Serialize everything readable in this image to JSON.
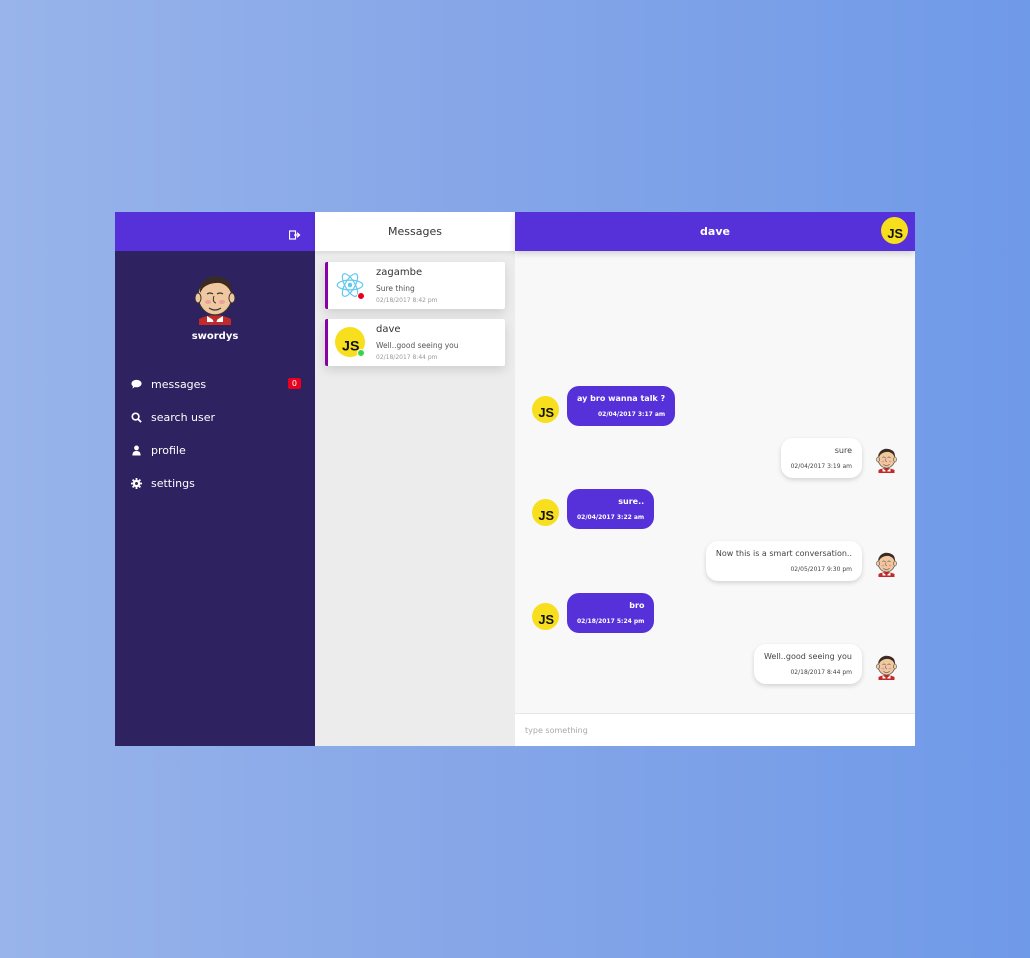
{
  "sidebar": {
    "logout_icon": "logout-icon",
    "username": "swordys",
    "nav": [
      {
        "label": "messages",
        "icon": "chat-bubble-icon",
        "badge": "0"
      },
      {
        "label": "search user",
        "icon": "search-icon"
      },
      {
        "label": "profile",
        "icon": "user-icon"
      },
      {
        "label": "settings",
        "icon": "gear-icon"
      }
    ]
  },
  "messages_list": {
    "title": "Messages",
    "conversations": [
      {
        "name": "zagambe",
        "preview": "Sure thing",
        "time": "02/18/2017 8:42 pm",
        "avatar": "react-logo-icon",
        "status_color": "#e8001e"
      },
      {
        "name": "dave",
        "preview": "Well..good seeing you",
        "time": "02/18/2017 8:44 pm",
        "avatar": "js-logo-icon",
        "status_color": "#39d24a"
      }
    ]
  },
  "chat": {
    "title": "dave",
    "messages": [
      {
        "direction": "in",
        "text": "ay bro wanna talk ?",
        "time": "02/04/2017 3:17 am"
      },
      {
        "direction": "out",
        "text": "sure",
        "time": "02/04/2017 3:19 am"
      },
      {
        "direction": "in",
        "text": "sure..",
        "time": "02/04/2017 3:22 am"
      },
      {
        "direction": "out",
        "text": "Now this is a smart conversation..",
        "time": "02/05/2017 9:30 pm"
      },
      {
        "direction": "in",
        "text": "bro",
        "time": "02/18/2017 5:24 pm"
      },
      {
        "direction": "out",
        "text": "Well..good seeing you",
        "time": "02/18/2017 8:44 pm"
      }
    ],
    "composer_placeholder": "type something"
  },
  "colors": {
    "accent": "#5630d8",
    "sidebar_bg": "#2f2260",
    "badge": "#e8001e",
    "js_yellow": "#f7df1e"
  }
}
